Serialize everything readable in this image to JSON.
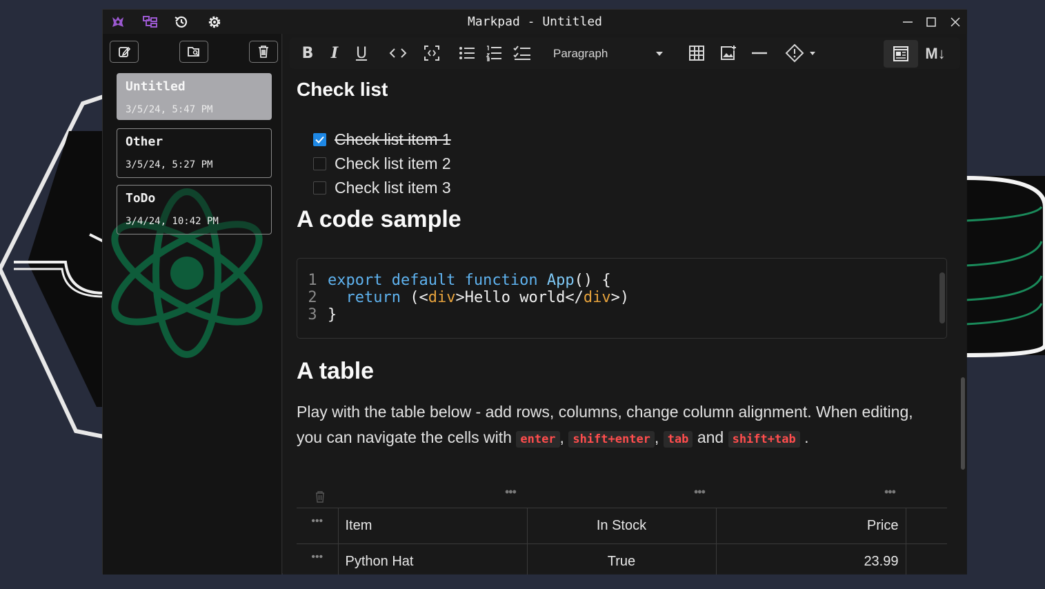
{
  "app": {
    "title": "Markpad - Untitled",
    "accent": "#9b59d0"
  },
  "titlebar": {
    "icons": [
      "logo-icon",
      "explorer-icon",
      "history-icon",
      "settings-icon"
    ],
    "controls": [
      "minimize-icon",
      "maximize-icon",
      "close-icon"
    ]
  },
  "sidebar": {
    "buttons": [
      "new-note-icon",
      "open-folder-icon",
      "delete-icon"
    ],
    "notes": [
      {
        "title": "Untitled",
        "date": "3/5/24, 5:47 PM",
        "active": true
      },
      {
        "title": "Other",
        "date": "3/5/24, 5:27 PM",
        "active": false
      },
      {
        "title": "ToDo",
        "date": "3/4/24, 10:42 PM",
        "active": false
      }
    ]
  },
  "toolbar": {
    "bold": "B",
    "italic": "I",
    "underline": "U",
    "paragraph": "Paragraph",
    "markdown_toggle": "M↓"
  },
  "doc": {
    "checklist_heading": "Check list",
    "checklist": [
      {
        "text": "Check list item 1",
        "checked": true
      },
      {
        "text": "Check list item 2",
        "checked": false
      },
      {
        "text": "Check list item 3",
        "checked": false
      }
    ],
    "code_heading": "A code sample",
    "code": {
      "line_numbers": [
        "1",
        "2",
        "3"
      ]
    },
    "table_heading": "A table",
    "paragraph": {
      "part1": "Play with the table below - add rows, columns, change column alignment. When editing, you can navigate the cells with",
      "k1": "enter",
      "sep1": ",",
      "k2": "shift+enter",
      "sep2": ",",
      "k3": "tab",
      "and": "and",
      "k4": "shift+tab",
      "end": "."
    },
    "table": {
      "headers": [
        "Item",
        "In Stock",
        "Price"
      ],
      "rows": [
        [
          "Python Hat",
          "True",
          "23.99"
        ]
      ]
    }
  }
}
